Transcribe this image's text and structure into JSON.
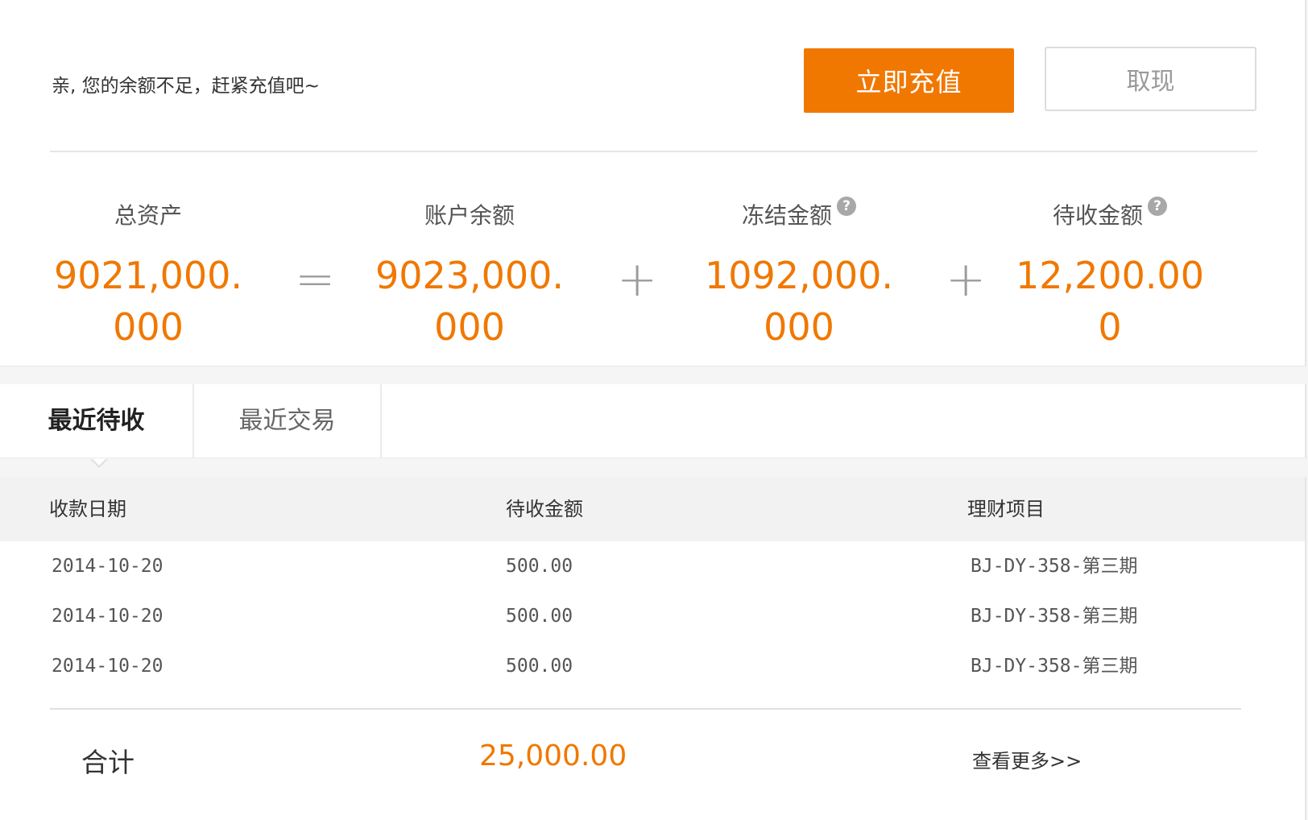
{
  "notice": "亲, 您的余额不足，赶紧充值吧~",
  "actions": {
    "recharge_label": "立即充值",
    "withdraw_label": "取现"
  },
  "summary": {
    "total_assets": {
      "label": "总资产",
      "value": "9021,000.000"
    },
    "equals": "=",
    "account_balance": {
      "label": "账户余额",
      "value": "9023,000.000"
    },
    "plus1": "+",
    "frozen_amount": {
      "label": "冻结金额",
      "value": "1092,000.000",
      "help": "?"
    },
    "plus2": "+",
    "receivable_amount": {
      "label": "待收金额",
      "value": "12,200.000",
      "help": "?"
    }
  },
  "tabs": {
    "recent_receivables": "最近待收",
    "recent_transactions": "最近交易"
  },
  "table": {
    "headers": {
      "date": "收款日期",
      "amount": "待收金额",
      "project": "理财项目"
    },
    "rows": [
      {
        "date": "2014-10-20",
        "amount": "500.00",
        "project": "BJ-DY-358-第三期"
      },
      {
        "date": "2014-10-20",
        "amount": "500.00",
        "project": "BJ-DY-358-第三期"
      },
      {
        "date": "2014-10-20",
        "amount": "500.00",
        "project": "BJ-DY-358-第三期"
      }
    ]
  },
  "footer": {
    "total_label": "合计",
    "total_value": "25,000.00",
    "more_label": "查看更多>>"
  },
  "colors": {
    "accent": "#f07800",
    "operator": "#9b9b9b",
    "header_bg": "#f2f2f2"
  }
}
